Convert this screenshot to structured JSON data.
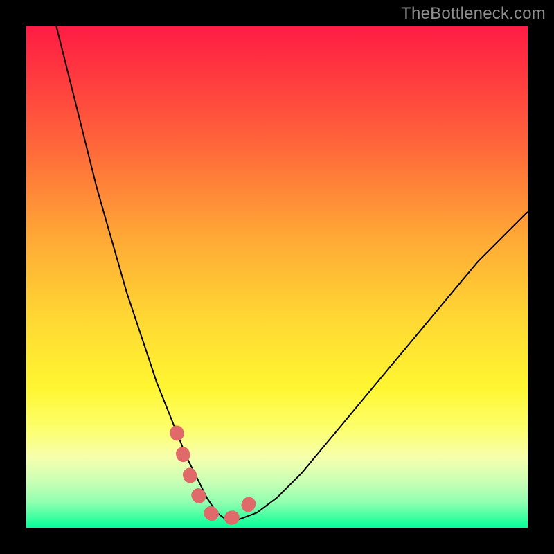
{
  "watermark": "TheBottleneck.com",
  "colors": {
    "curve_stroke": "#000000",
    "overlay_stroke": "#e06a6a",
    "background": "#000000"
  },
  "chart_data": {
    "type": "line",
    "title": "",
    "xlabel": "",
    "ylabel": "",
    "xlim": [
      0,
      100
    ],
    "ylim": [
      0,
      100
    ],
    "series": [
      {
        "name": "bottleneck-curve",
        "x": [
          6,
          8,
          10,
          12,
          14,
          16,
          18,
          20,
          22,
          24,
          26,
          28,
          30,
          32,
          34,
          36,
          38,
          40,
          42,
          46,
          50,
          55,
          60,
          65,
          70,
          75,
          80,
          85,
          90,
          95,
          100
        ],
        "values": [
          100,
          92,
          84,
          76,
          68,
          61,
          54,
          47,
          41,
          35,
          29,
          24,
          19,
          14,
          10,
          6,
          3,
          1.5,
          1.5,
          3,
          6,
          11,
          17,
          23,
          29,
          35,
          41,
          47,
          53,
          58,
          63
        ]
      }
    ],
    "overlay": {
      "name": "highlight-range",
      "type": "scatter",
      "x": [
        30,
        32,
        34,
        36,
        38,
        40,
        42,
        44,
        46
      ],
      "values": [
        19,
        12,
        7,
        3.5,
        2,
        1.8,
        2.2,
        4,
        8
      ]
    }
  }
}
